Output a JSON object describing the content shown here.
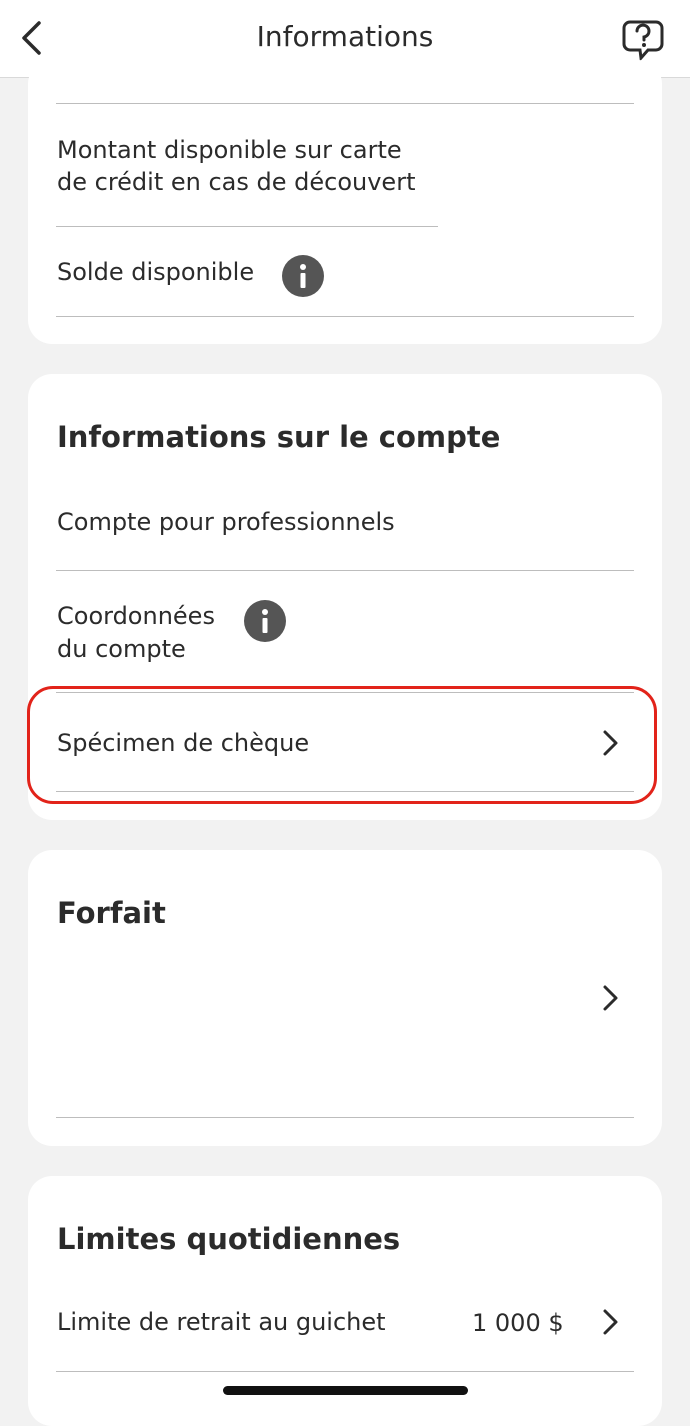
{
  "header": {
    "title": "Informations"
  },
  "card_top": {
    "item1_line1": "Montant disponible sur carte",
    "item1_line2": "de crédit en cas de découvert",
    "item2_label": "Solde disponible"
  },
  "account_info": {
    "heading": "Informations sur le compte",
    "item1_label": "Compte pour professionnels",
    "item2_line1": "Coordonnées",
    "item2_line2": "du compte",
    "item3_label": "Spécimen de chèque"
  },
  "forfait": {
    "heading": "Forfait"
  },
  "limits": {
    "heading": "Limites quotidiennes",
    "item1_label": "Limite de retrait au guichet",
    "item1_value": "1 000 $"
  },
  "colors": {
    "highlight": "#e2231a",
    "info_icon": "#555555",
    "background": "#f2f2f2"
  }
}
